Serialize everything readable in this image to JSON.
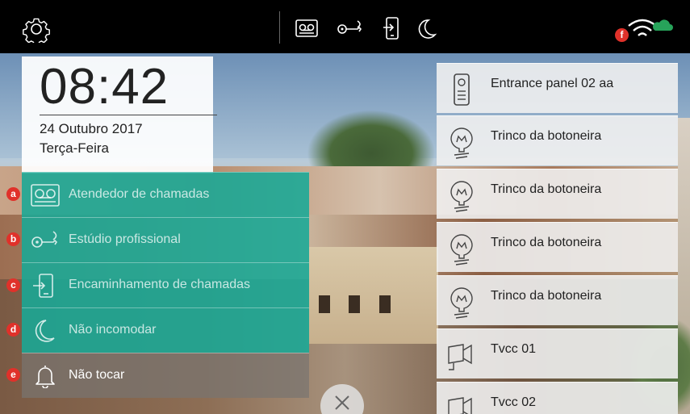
{
  "topbar": {
    "settings_icon": "gear-icon",
    "status_icons": [
      "voicemail-icon",
      "key-icon",
      "forward-icon",
      "moon-icon"
    ],
    "wifi_icon": "wifi-icon",
    "cloud_icon": "cloud-icon",
    "wifi_badge": "f",
    "colors": {
      "badge": "#e0312a",
      "cloud": "#27a35a"
    }
  },
  "clock": {
    "time": "08:42",
    "date": "24 Outubro 2017",
    "weekday": "Terça-Feira"
  },
  "menu": [
    {
      "badge": "a",
      "icon": "voicemail-icon",
      "label": "Atendedor de chamadas"
    },
    {
      "badge": "b",
      "icon": "key-icon",
      "label": "Estúdio profissional"
    },
    {
      "badge": "c",
      "icon": "forward-icon",
      "label": "Encaminhamento de chamadas"
    },
    {
      "badge": "d",
      "icon": "moon-icon",
      "label": "Não incomodar"
    },
    {
      "badge": "e",
      "icon": "bell-icon",
      "label": "Não tocar"
    }
  ],
  "devices": [
    {
      "icon": "entrance-panel-icon",
      "label": "Entrance panel 02 aa"
    },
    {
      "icon": "lock-release-icon",
      "label": "Trinco da botoneira"
    },
    {
      "icon": "lock-release-icon",
      "label": "Trinco da botoneira"
    },
    {
      "icon": "lock-release-icon",
      "label": "Trinco da botoneira"
    },
    {
      "icon": "lock-release-icon",
      "label": "Trinco da botoneira"
    },
    {
      "icon": "cctv-camera-icon",
      "label": "Tvcc 01"
    },
    {
      "icon": "cctv-camera-icon",
      "label": "Tvcc 02"
    }
  ],
  "close_icon": "close-icon",
  "accent_color": "#18a896"
}
